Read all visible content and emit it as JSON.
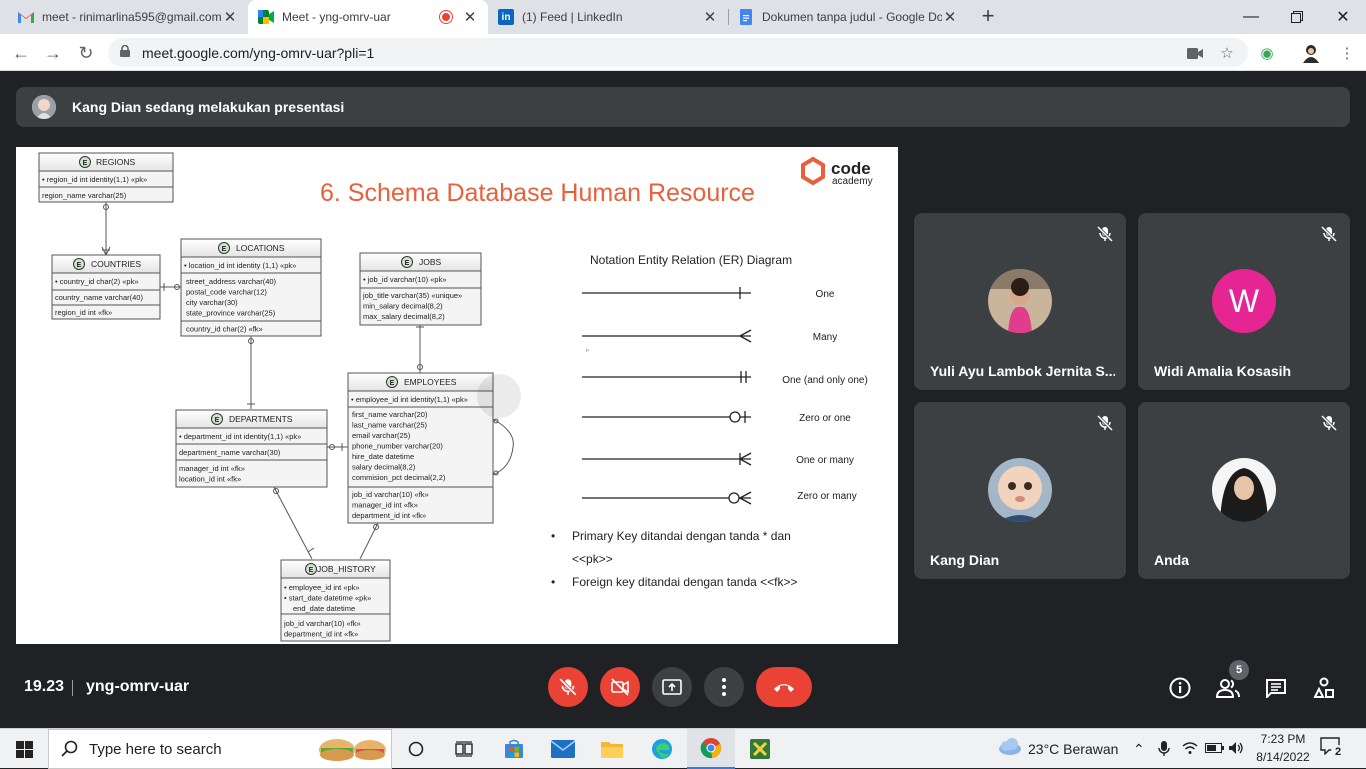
{
  "browser": {
    "tabs": [
      {
        "title": "meet - rinimarlina595@gmail.com",
        "icon": "gmail-icon"
      },
      {
        "title": "Meet - yng-omrv-uar",
        "icon": "meet-icon",
        "active": true
      },
      {
        "title": "(1) Feed | LinkedIn",
        "icon": "linkedin-icon"
      },
      {
        "title": "Dokumen tanpa judul - Google Dokumen",
        "icon": "docs-icon"
      }
    ],
    "url": "meet.google.com/yng-omrv-uar?pli=1"
  },
  "meet": {
    "presenting_text": "Kang Dian sedang melakukan presentasi",
    "participants": [
      {
        "name": "Yuli Ayu Lambok Jernita S...",
        "muted": true
      },
      {
        "name": "Widi Amalia Kosasih",
        "initial": "W",
        "muted": true,
        "color": "#e52592"
      },
      {
        "name": "Kang Dian",
        "muted": true
      },
      {
        "name": "Anda",
        "muted": true
      }
    ],
    "time": "19.23",
    "meeting_code": "yng-omrv-uar",
    "people_count": "5"
  },
  "slide": {
    "title": "6. Schema Database Human Resource",
    "brand_line1": "code",
    "brand_line2": "academy",
    "notation_title": "Notation Entity Relation (ER) Diagram",
    "notations": [
      "One",
      "Many",
      "One (and only one)",
      "Zero or one",
      "One or many",
      "Zero or many"
    ],
    "bullets": [
      "Primary Key ditandai dengan tanda * dan",
      "<<pk>>",
      "Foreign key ditandai dengan tanda <<fk>>"
    ],
    "tables": {
      "regions": {
        "name": "REGIONS",
        "pk": [
          "region_id  int identity(1,1) «pk»"
        ],
        "cols": [
          "region_name varchar(25)"
        ],
        "fks": []
      },
      "countries": {
        "name": "COUNTRIES",
        "pk": [
          "country_id char(2) «pk»"
        ],
        "cols": [
          "country_name varchar(40)"
        ],
        "fks": [
          "region_id int «fk»"
        ]
      },
      "locations": {
        "name": "LOCATIONS",
        "pk": [
          "location_id int identity (1,1) «pk»"
        ],
        "cols": [
          "street_address varchar(40)",
          "postal_code varchar(12)",
          "city varchar(30)",
          "state_province varchar(25)"
        ],
        "fks": [
          "country_id char(2) «fk»"
        ]
      },
      "jobs": {
        "name": "JOBS",
        "pk": [
          "job_id varchar(10) «pk»"
        ],
        "cols": [
          "job_title varchar(35) «unique»",
          "min_salary decimal(8,2)",
          "max_salary decimal(8,2)"
        ],
        "fks": []
      },
      "employees": {
        "name": "EMPLOYEES",
        "pk": [
          "employee_id int identity(1,1) «pk»"
        ],
        "cols": [
          "first_name varchar(20)",
          "last_name varchar(25)",
          "email varchar(25)",
          "phone_number varchar(20)",
          "hire_date datetime",
          "salary decimal(8,2)",
          "commision_pct decimal(2,2)"
        ],
        "fks": [
          "job_id varchar(10) «fk»",
          "manager_id int «fk»",
          "department_id int «fk»"
        ]
      },
      "departments": {
        "name": "DEPARTMENTS",
        "pk": [
          "department_id int identity(1,1) «pk»"
        ],
        "cols": [
          "department_name varchar(30)"
        ],
        "fks": [
          "manager_id int «fk»",
          "location_id int «fk»"
        ]
      },
      "job_history": {
        "name": "JOB_HISTORY",
        "pk": [
          "employee_id int «pk»",
          "start_date datetime «pk»",
          "end_date datetime"
        ],
        "cols": [],
        "fks": [
          "job_id varchar(10) «fk»",
          "department_id int «fk»"
        ]
      }
    }
  },
  "taskbar": {
    "search_placeholder": "Type here to search",
    "weather": "23°C  Berawan",
    "time": "7:23 PM",
    "date": "8/14/2022",
    "notifications": "2"
  },
  "colors": {
    "accent_red": "#ea4335",
    "title_orange": "#e8603c",
    "tile_bg": "#3c4043",
    "meet_bg": "#202124"
  }
}
